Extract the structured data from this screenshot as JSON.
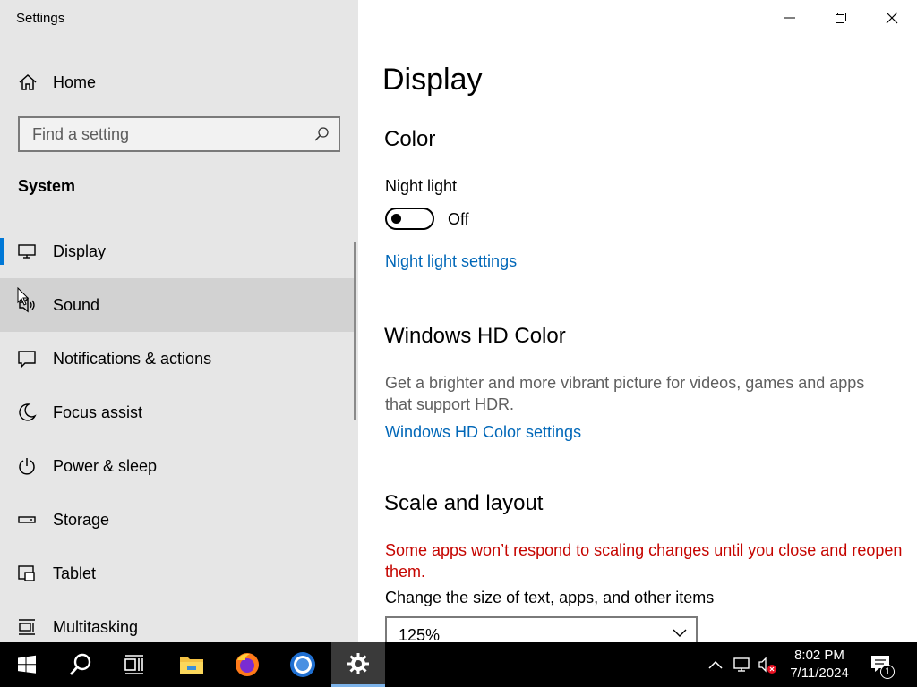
{
  "window": {
    "app_title": "Settings",
    "minimize_icon": "minimize-icon",
    "restore_icon": "restore-icon",
    "close_icon": "close-icon"
  },
  "sidebar": {
    "home_label": "Home",
    "search_placeholder": "Find a setting",
    "section_label": "System",
    "items": [
      {
        "label": "Display",
        "icon": "monitor-icon",
        "selected": true
      },
      {
        "label": "Sound",
        "icon": "speaker-icon",
        "hovered": true
      },
      {
        "label": "Notifications & actions",
        "icon": "notification-icon"
      },
      {
        "label": "Focus assist",
        "icon": "moon-icon"
      },
      {
        "label": "Power & sleep",
        "icon": "power-icon"
      },
      {
        "label": "Storage",
        "icon": "storage-icon"
      },
      {
        "label": "Tablet",
        "icon": "tablet-icon"
      },
      {
        "label": "Multitasking",
        "icon": "multitasking-icon"
      }
    ]
  },
  "main": {
    "page_title": "Display",
    "color": {
      "heading": "Color",
      "night_light_label": "Night light",
      "night_light_state": "Off",
      "night_light_on": false,
      "night_light_settings_link": "Night light settings"
    },
    "hd_color": {
      "heading": "Windows HD Color",
      "description": "Get a brighter and more vibrant picture for videos, games and apps that support HDR.",
      "settings_link": "Windows HD Color settings"
    },
    "scale_layout": {
      "heading": "Scale and layout",
      "warning": "Some apps won’t respond to scaling changes until you close and reopen them.",
      "size_label": "Change the size of text, apps, and other items",
      "size_value": "125%"
    }
  },
  "taskbar": {
    "apps": [
      "start-icon",
      "search-icon",
      "task-view-icon",
      "file-explorer-icon",
      "firefox-icon",
      "chrome-icon",
      "settings-icon"
    ],
    "active_app": "settings-icon",
    "tray": [
      "chevron-up-icon",
      "network-icon",
      "volume-muted-icon"
    ],
    "time": "8:02 PM",
    "date": "7/11/2024",
    "notification_count": "1"
  },
  "colors": {
    "accent": "#0078d7",
    "link": "#0067b8",
    "warning": "#c50500",
    "sidebar_bg": "#e6e6e6",
    "hover_bg": "#d2d2d2",
    "taskbar_bg": "#000000"
  }
}
